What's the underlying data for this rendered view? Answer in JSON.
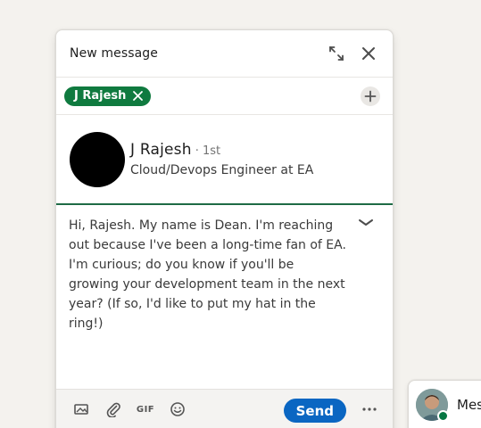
{
  "compose": {
    "title": "New message",
    "expand_icon": "expand-arrows-icon",
    "close_icon": "close-icon",
    "recipient": {
      "chip_label": "J Rajesh",
      "chip_color": "#0f7a3f",
      "remove_icon": "close-icon"
    },
    "add_recipient_icon": "plus-icon",
    "profile": {
      "name": "J Rajesh",
      "degree": "· 1st",
      "headline": "Cloud/Devops Engineer at EA"
    },
    "message_body": "Hi, Rajesh. My name is Dean. I'm reaching\nout because I've been a long-time fan of EA.\nI'm curious; do you know if you'll be\ngrowing your development team in the next\nyear? (If so, I'd like to put my hat in the\nring!)",
    "collapse_icon": "chevron-down-icon",
    "toolbar": {
      "image_icon": "image-icon",
      "attach_icon": "paperclip-icon",
      "gif_label": "GIF",
      "emoji_icon": "smiley-icon",
      "send_label": "Send",
      "send_color": "#0a66c2",
      "more_icon": "more-horizontal-icon"
    }
  },
  "messaging_widget": {
    "label": "Messaging",
    "online_status_color": "#057642"
  }
}
